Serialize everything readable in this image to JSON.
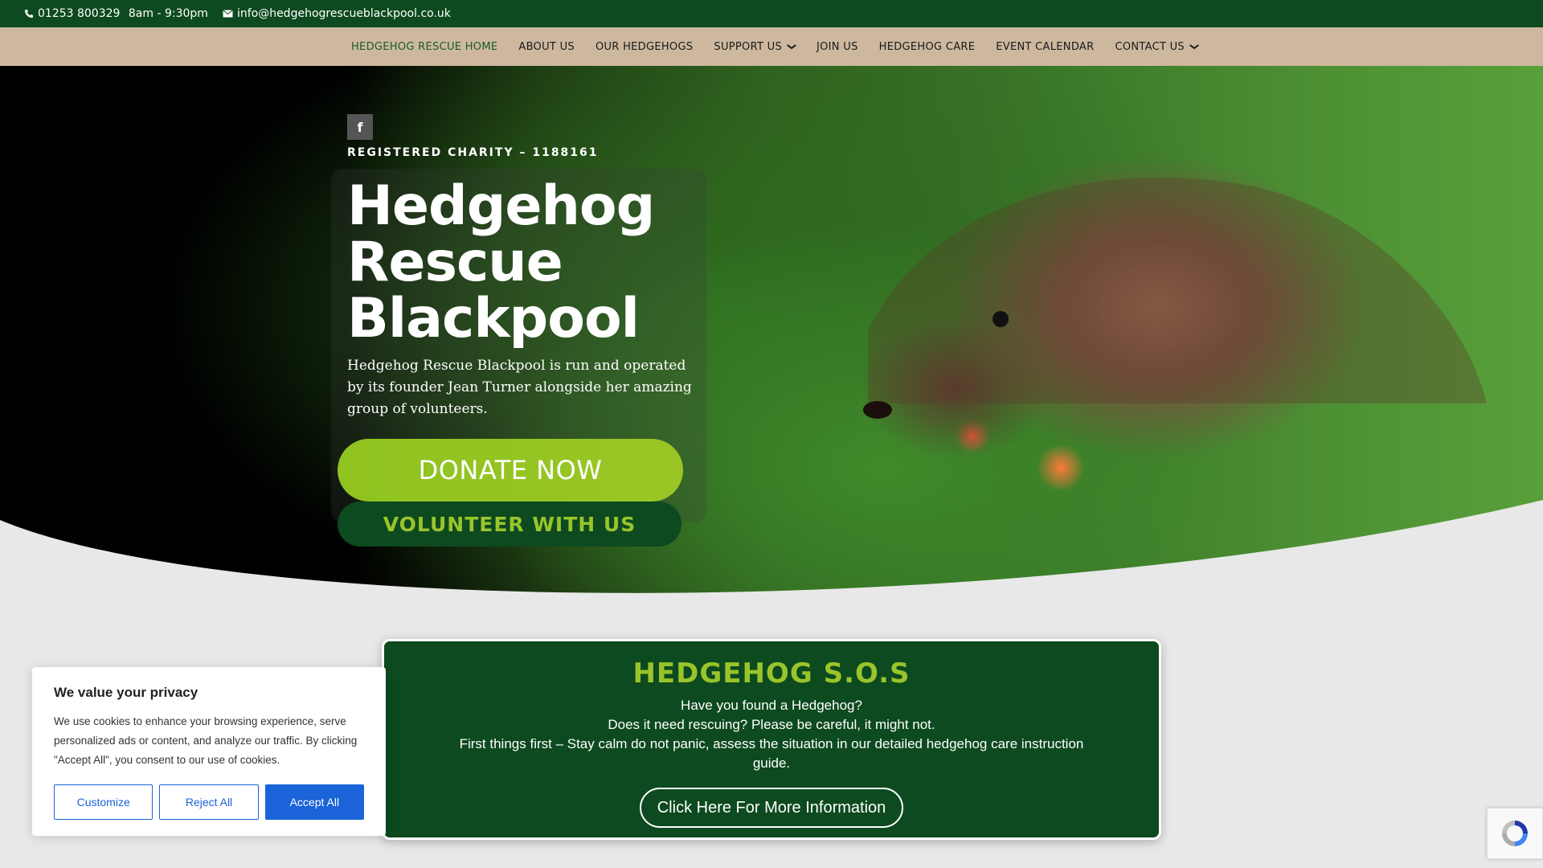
{
  "topbar": {
    "phone": "01253 800329",
    "hours": "8am - 9:30pm",
    "email": "info@hedgehogrescueblackpool.co.uk"
  },
  "nav": {
    "items": [
      {
        "label": "HEDGEHOG RESCUE HOME",
        "active": true,
        "dropdown": false
      },
      {
        "label": "ABOUT US",
        "active": false,
        "dropdown": false
      },
      {
        "label": "OUR HEDGEHOGS",
        "active": false,
        "dropdown": false
      },
      {
        "label": "SUPPORT US",
        "active": false,
        "dropdown": true
      },
      {
        "label": "JOIN US",
        "active": false,
        "dropdown": false
      },
      {
        "label": "HEDGEHOG CARE",
        "active": false,
        "dropdown": false
      },
      {
        "label": "EVENT CALENDAR",
        "active": false,
        "dropdown": false
      },
      {
        "label": "CONTACT US",
        "active": false,
        "dropdown": true
      }
    ]
  },
  "hero": {
    "social_icon": "facebook-icon",
    "charity": "REGISTERED CHARITY – 1188161",
    "title": "Hedgehog Rescue Blackpool",
    "text": "Hedgehog Rescue Blackpool is run and operated by its founder Jean Turner alongside her amazing group of volunteers.",
    "donate_label": "DONATE NOW",
    "volunteer_label": "VOLUNTEER WITH US"
  },
  "sos": {
    "title": "HEDGEHOG S.O.S",
    "line1": "Have you found a Hedgehog?",
    "line2": "Does it need rescuing? Please be careful, it might not.",
    "line3": "First things first – Stay calm do not panic, assess the situation in our detailed hedgehog care  instruction guide.",
    "button": "Click Here For More Information"
  },
  "cookie": {
    "title": "We value your privacy",
    "text": "We use cookies to enhance your browsing experience, serve personalized ads or content, and analyze our traffic. By clicking \"Accept All\", you consent to our use of cookies.",
    "customize": "Customize",
    "reject": "Reject All",
    "accept": "Accept All"
  },
  "colors": {
    "dark_green": "#0d4a1f",
    "lime": "#99c42b",
    "nav_bg": "#cdb89f",
    "cookie_blue": "#1a63d8"
  }
}
